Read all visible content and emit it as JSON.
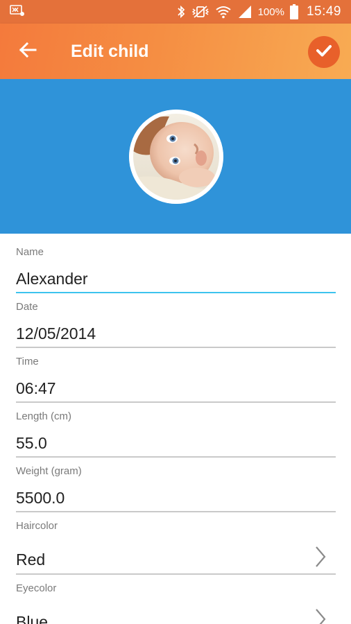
{
  "status_bar": {
    "battery": "100%",
    "time": "15:49",
    "icons": [
      "notification-icon",
      "bluetooth-icon",
      "vibrate-mute-icon",
      "wifi-icon",
      "signal-icon",
      "battery-icon"
    ]
  },
  "app_bar": {
    "title": "Edit child",
    "back_icon": "arrow-back-icon",
    "confirm_icon": "check-icon",
    "accent_color": "#f58e43"
  },
  "header": {
    "background_color": "#2f93d9",
    "avatar": "baby-photo"
  },
  "form": {
    "fields": [
      {
        "label": "Name",
        "value": "Alexander"
      },
      {
        "label": "Date",
        "value": "12/05/2014"
      },
      {
        "label": "Time",
        "value": "06:47"
      },
      {
        "label": "Length (cm)",
        "value": "55.0"
      },
      {
        "label": "Weight (gram)",
        "value": "5500.0"
      },
      {
        "label": "Haircolor",
        "value": "Red"
      },
      {
        "label": "Eyecolor",
        "value": "Blue"
      }
    ]
  }
}
